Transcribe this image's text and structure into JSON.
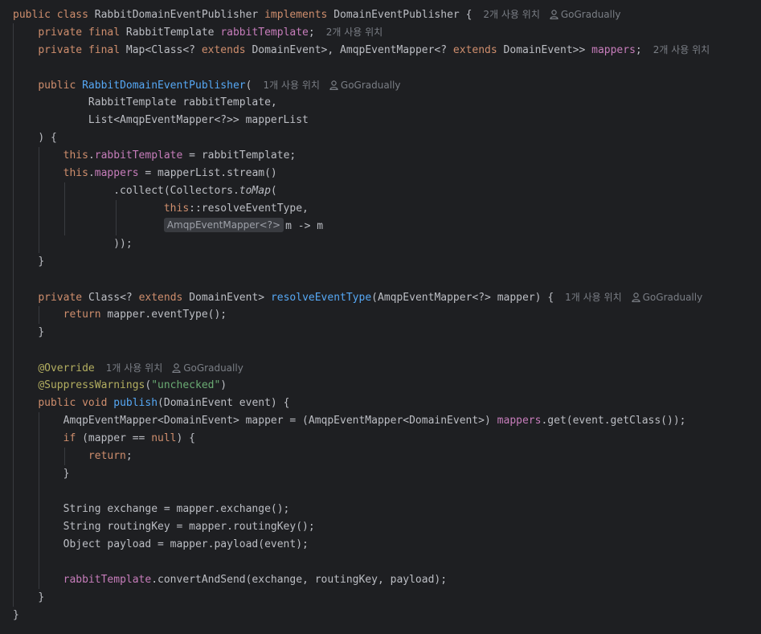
{
  "usage": {
    "two": "2개 사용 위치",
    "one": "1개 사용 위치",
    "author": "GoGradually"
  },
  "code": {
    "kw_public": "public",
    "kw_class": "class",
    "class_name": "RabbitDomainEventPublisher",
    "kw_implements": "implements",
    "iface_tail": "DomainEventPublisher {",
    "kw_private": "private",
    "kw_final": "final",
    "type_rabbit_template": "RabbitTemplate",
    "field_rabbit_template": "rabbitTemplate",
    "semicolon": ";",
    "map_open": "Map<Class<?",
    "kw_extends": "extends",
    "map_mid": "DomainEvent>, AmqpEventMapper<?",
    "map_close": "DomainEvent>>",
    "field_mappers": "mappers",
    "ctor_name": "RabbitDomainEventPublisher",
    "open_paren": "(",
    "param1": "RabbitTemplate rabbitTemplate,",
    "param2": "List<AmqpEventMapper<?>> mapperList",
    "ctor_close": ") {",
    "kw_this": "this",
    "dot": ".",
    "assign_rabbit": " = rabbitTemplate;",
    "assign_mappers": " = mapperList.stream()",
    "collect_open": ".collect(Collectors.",
    "to_map": "toMap",
    "collect_paren": "(",
    "method_ref": "::resolveEventType,",
    "param_hint": "AmqpEventMapper<?>",
    "lambda": "m -> m",
    "collect_close": "));",
    "close_brace": "}",
    "class_wild": "Class<?",
    "domain_event_gt": "DomainEvent>",
    "resolve_name": "resolveEventType",
    "resolve_params": "(AmqpEventMapper<?> mapper) {",
    "kw_return": "return",
    "return_mapper": "mapper.eventType();",
    "ann_override": "@Override",
    "ann_suppress": "@SuppressWarnings",
    "suppress_value": "\"unchecked\"",
    "kw_void": "void",
    "publish_name": "publish",
    "publish_params": "(DomainEvent event) {",
    "cast_left": "AmqpEventMapper<DomainEvent> mapper = (AmqpEventMapper<DomainEvent>) ",
    "get_call": ".get(event.getClass());",
    "kw_if": "if",
    "if_cond": " (mapper == ",
    "kw_null": "null",
    "if_close": ") {",
    "return_empty": ";",
    "exchange_line": "String exchange = mapper.exchange();",
    "routing_line": "String routingKey = mapper.routingKey();",
    "payload_line": "Object payload = mapper.payload(event);",
    "send_call": ".convertAndSend(exchange, routingKey, payload);"
  }
}
